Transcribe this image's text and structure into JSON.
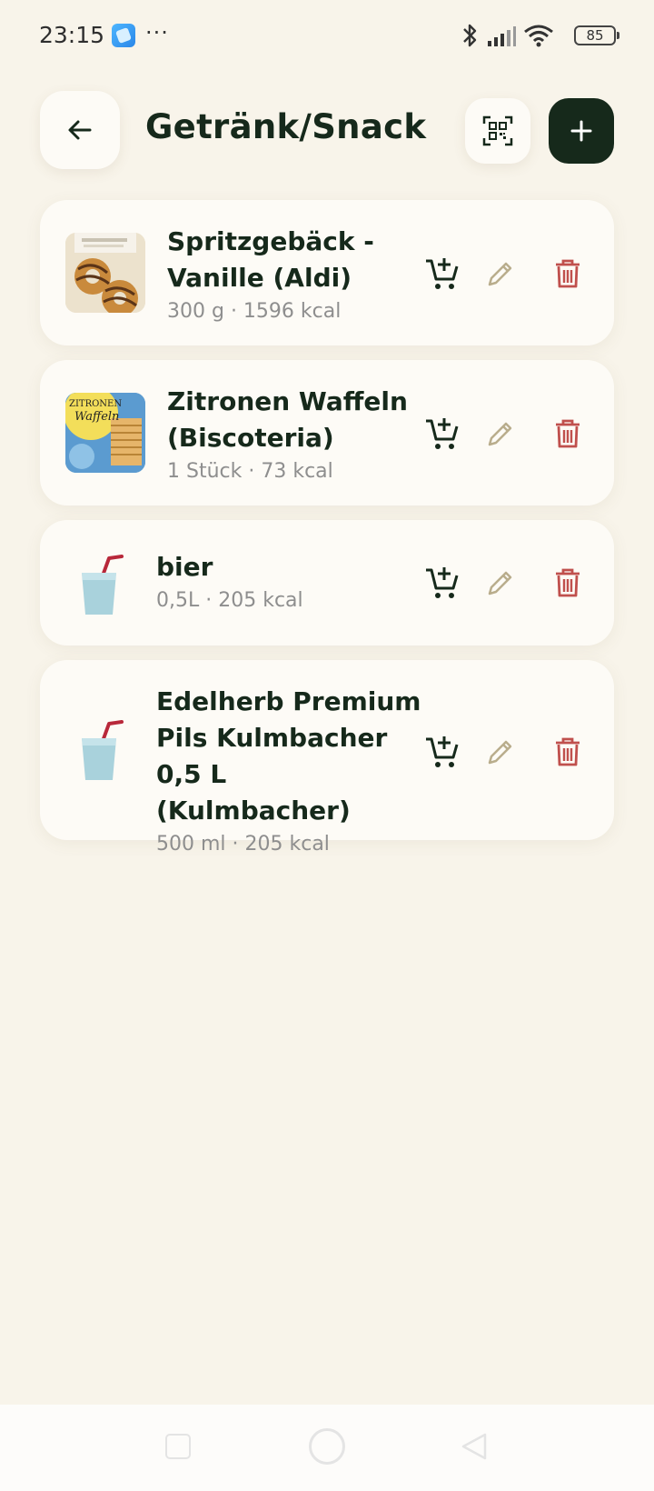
{
  "status": {
    "time": "23:15",
    "dots": "···",
    "battery": "85"
  },
  "header": {
    "title": "Getränk/Snack"
  },
  "items": [
    {
      "name": "Spritzgebäck - Vanille (Aldi)",
      "meta": "300 g · 1596 kcal",
      "icon": "photo-cookies"
    },
    {
      "name": "Zitronen Waffeln (Biscoteria)",
      "meta": "1 Stück · 73 kcal",
      "icon": "photo-waffles",
      "thumb_text": "ZITRONEN Waffeln"
    },
    {
      "name": "bier",
      "meta": "0,5L · 205 kcal",
      "icon": "cup-with-straw-icon"
    },
    {
      "name": "Edelherb Premium Pils Kulmbacher 0,5 L (Kulmbacher)",
      "meta": "500 ml · 205 kcal",
      "icon": "cup-with-straw-icon"
    }
  ],
  "colors": {
    "background": "#f8f4ea",
    "card": "#fdfbf6",
    "dark_green": "#16291b",
    "edit": "#b9ad8c",
    "delete": "#c0504d"
  }
}
